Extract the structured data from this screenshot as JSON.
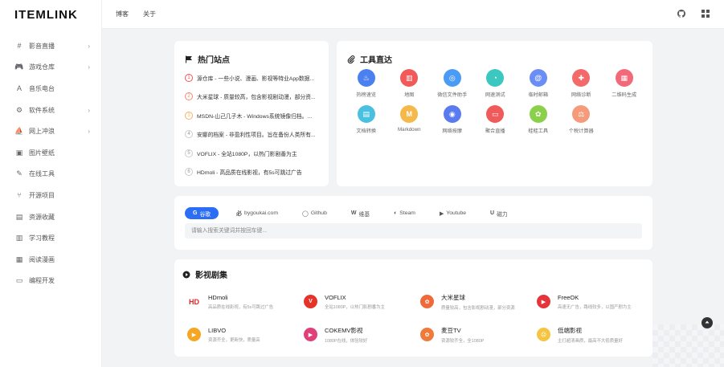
{
  "brand": {
    "logo": "ITEMLINK"
  },
  "header": {
    "links": [
      "博客",
      "关于"
    ],
    "icons": [
      "github-icon",
      "grid-icon"
    ]
  },
  "sidebar": {
    "items": [
      {
        "label": "影音直播",
        "icon": "#",
        "arrow": true
      },
      {
        "label": "游戏仓库",
        "icon": "🎮",
        "arrow": true
      },
      {
        "label": "音乐电台",
        "icon": "A",
        "arrow": false
      },
      {
        "label": "软件系统",
        "icon": "⚙",
        "arrow": true
      },
      {
        "label": "网上冲浪",
        "icon": "⛵",
        "arrow": true
      },
      {
        "label": "图片壁纸",
        "icon": "▣",
        "arrow": false
      },
      {
        "label": "在线工具",
        "icon": "✎",
        "arrow": false
      },
      {
        "label": "开源项目",
        "icon": "⑂",
        "arrow": false
      },
      {
        "label": "资源收藏",
        "icon": "▤",
        "arrow": false
      },
      {
        "label": "学习教程",
        "icon": "▥",
        "arrow": false
      },
      {
        "label": "阅读漫画",
        "icon": "▦",
        "arrow": false
      },
      {
        "label": "编程开发",
        "icon": "▭",
        "arrow": false
      }
    ]
  },
  "hot": {
    "title": "热门站点",
    "items": [
      {
        "num": "1",
        "text": "源仓库 - 一些小说、漫画、影视等特业App数据..."
      },
      {
        "num": "2",
        "text": "大米星球 - 质量较高，包含影视剧动漫，部分资..."
      },
      {
        "num": "3",
        "text": "MSDN-山己几子木 - Windows系统镜像归档。..."
      },
      {
        "num": "4",
        "text": "安娜的档案 - 非盈利性项目。旨在备份人类所有..."
      },
      {
        "num": "5",
        "text": "VOFLIX - 全站1080P，以热门影剧番为主"
      },
      {
        "num": "6",
        "text": "HDmoli - 高品质在线影视，有5s可跳过广告"
      }
    ]
  },
  "tools": {
    "title": "工具直达",
    "items": [
      {
        "label": "热榜速览",
        "icon": "flame-icon",
        "glyph": "♨",
        "color": "#4a80f0"
      },
      {
        "label": "地图",
        "icon": "map-icon",
        "glyph": "▥",
        "color": "#f05a5a"
      },
      {
        "label": "微信文件助手",
        "icon": "wechat-icon",
        "glyph": "◎",
        "color": "#4a9bf5"
      },
      {
        "label": "网速测试",
        "icon": "speed-icon",
        "glyph": "◔",
        "color": "#3cc8c0"
      },
      {
        "label": "临时邮箱",
        "icon": "at-icon",
        "glyph": "@",
        "color": "#6a8ef5"
      },
      {
        "label": "网络诊断",
        "icon": "network-icon",
        "glyph": "✚",
        "color": "#f26a6a"
      },
      {
        "label": "二维码生成",
        "icon": "qrcode-icon",
        "glyph": "▦",
        "color": "#f26a7a"
      },
      {
        "label": "文档转换",
        "icon": "doc-icon",
        "glyph": "▤",
        "color": "#4ac0e0"
      },
      {
        "label": "Markdown",
        "icon": "markdown-icon",
        "glyph": "M",
        "color": "#f5b84a"
      },
      {
        "label": "网络按摩",
        "icon": "globe-icon",
        "glyph": "◉",
        "color": "#5a7af0"
      },
      {
        "label": "聚合直播",
        "icon": "tv-icon",
        "glyph": "▭",
        "color": "#f05a5a"
      },
      {
        "label": "蛙蛙工具",
        "icon": "frog-icon",
        "glyph": "✿",
        "color": "#8ad04a"
      },
      {
        "label": "个税计算器",
        "icon": "scale-icon",
        "glyph": "⚖",
        "color": "#f59a7a"
      }
    ]
  },
  "search": {
    "engines": [
      {
        "label": "谷歌",
        "glyph": "G",
        "active": true
      },
      {
        "label": "bygoukai.com",
        "glyph": "必",
        "active": false
      },
      {
        "label": "Github",
        "glyph": "◯",
        "active": false
      },
      {
        "label": "维基",
        "glyph": "W",
        "active": false
      },
      {
        "label": "Steam",
        "glyph": "◐",
        "active": false
      },
      {
        "label": "Youtube",
        "glyph": "▶",
        "active": false
      },
      {
        "label": "磁力",
        "glyph": "U",
        "active": false
      }
    ],
    "placeholder": "请输入搜索关键词并按回车键..."
  },
  "videos": {
    "title": "影视剧集",
    "items": [
      {
        "name": "HDmoli",
        "desc": "高品质在线影视，有5s可跳过广告",
        "glyph": "HD",
        "color": "#e32626",
        "square": true
      },
      {
        "name": "VOFLIX",
        "desc": "全站1080P，以热门影剧番为主",
        "glyph": "V",
        "color": "#e5332a"
      },
      {
        "name": "大米星球",
        "desc": "质量较高，包含影视剧动漫，部分资源",
        "glyph": "✿",
        "color": "#ef6a3a"
      },
      {
        "name": "FreeOK",
        "desc": "高速无广告，路线较多，以国产剧为主",
        "glyph": "▶",
        "color": "#e6353a"
      },
      {
        "name": "LIBVO",
        "desc": "资源齐全，更新快，质量高",
        "glyph": "▶",
        "color": "#f5a623"
      },
      {
        "name": "COKEMV影视",
        "desc": "1080P在线，体验较好",
        "glyph": "▶",
        "color": "#e0407a"
      },
      {
        "name": "麦豆TV",
        "desc": "资源较齐全，全1080P",
        "glyph": "✿",
        "color": "#f07a3a"
      },
      {
        "name": "低端影视",
        "desc": "主打超清画质，最高不大低质量好",
        "glyph": "☹",
        "color": "#f5c542"
      }
    ]
  }
}
